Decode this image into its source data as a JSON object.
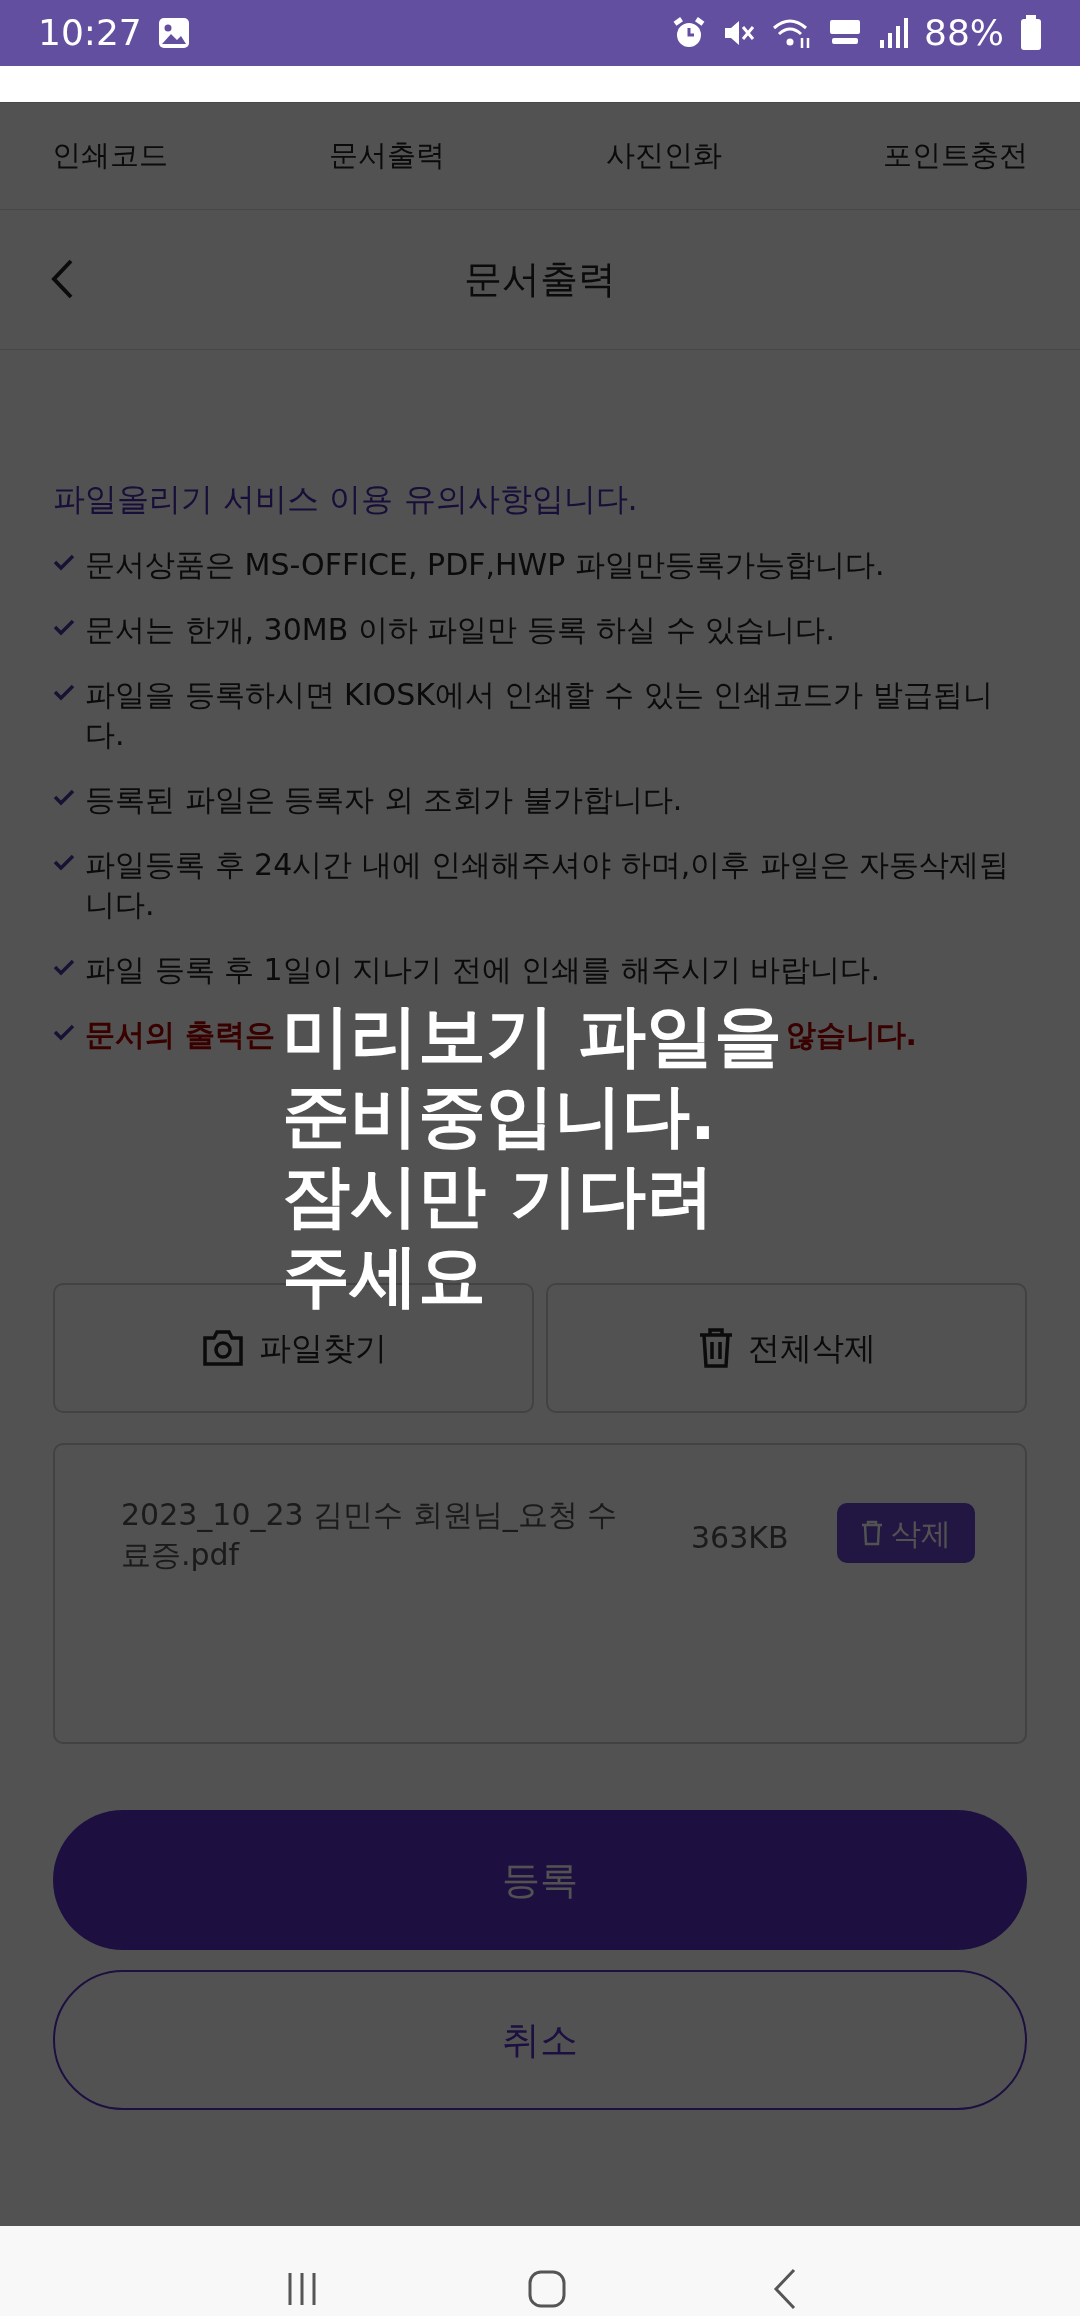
{
  "status_bar": {
    "time": "10:27",
    "battery": "88%"
  },
  "top_tabs": [
    {
      "label": "인쇄코드",
      "selected": false
    },
    {
      "label": "문서출력",
      "selected": false
    },
    {
      "label": "사진인화",
      "selected": false
    },
    {
      "label": "포인트충전",
      "selected": false
    }
  ],
  "header": {
    "title": "문서출력"
  },
  "notice": {
    "heading": "파일올리기 서비스 이용 유의사항입니다.",
    "items": [
      {
        "kind": "normal",
        "text": "문서상품은 MS-OFFICE, PDF,HWP 파일만등록가능합니다."
      },
      {
        "kind": "normal",
        "text": "문서는 한개, 30MB 이하 파일만 등록 하실 수 있습니다."
      },
      {
        "kind": "normal",
        "text": "파일을 등록하시면 KIOSK에서 인쇄할 수 있는 인쇄코드가 발급됩니다."
      },
      {
        "kind": "normal",
        "text": "등록된 파일은 등록자 외 조회가 불가합니다."
      },
      {
        "kind": "normal",
        "text": "파일등록 후 24시간 내에 인쇄해주셔야 하며,이후 파일은 자동삭제됩니다."
      },
      {
        "kind": "normal",
        "text": "파일 등록 후 1일이 지나기 전에 인쇄를 해주시기 바랍니다."
      },
      {
        "kind": "warning",
        "parts": [
          "문서의 출력은",
          "않습니다."
        ]
      }
    ]
  },
  "actions": [
    {
      "kind": "camera",
      "label": "파일찾기"
    },
    {
      "kind": "trash",
      "label": "전체삭제"
    }
  ],
  "files": [
    {
      "name": "2023_10_23 김민수 회원님_요청 수료증.pdf",
      "size": "363KB",
      "delete_label": "삭제"
    }
  ],
  "buttons": {
    "submit": "등록",
    "cancel": "취소"
  },
  "overlay": {
    "lines": [
      "미리보기 파일을",
      "준비중입니다.",
      "잠시만 기다려",
      "주세요"
    ]
  }
}
